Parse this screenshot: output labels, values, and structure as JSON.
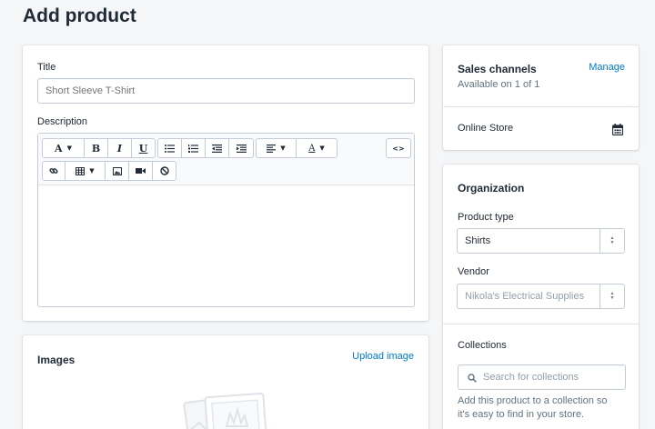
{
  "page": {
    "title": "Add product"
  },
  "main": {
    "title_label": "Title",
    "title_placeholder": "Short Sleeve T-Shirt",
    "description_label": "Description",
    "toolbar": {
      "font_button": "A",
      "bold": "B",
      "italic": "I",
      "underline": "U",
      "color_button": "A",
      "code_button": "<>"
    },
    "images": {
      "title": "Images",
      "upload_link": "Upload image"
    }
  },
  "sidebar": {
    "sales_channels": {
      "title": "Sales channels",
      "manage_link": "Manage",
      "availability": "Available on 1 of 1",
      "channel_name": "Online Store"
    },
    "organization": {
      "title": "Organization",
      "product_type_label": "Product type",
      "product_type_value": "Shirts",
      "vendor_label": "Vendor",
      "vendor_placeholder": "Nikola's Electrical Supplies",
      "collections_label": "Collections",
      "collections_placeholder": "Search for collections",
      "collections_help": "Add this product to a collection so it's easy to find in your store."
    }
  },
  "colors": {
    "accent": "#007ace",
    "background": "#f4f6f8"
  }
}
